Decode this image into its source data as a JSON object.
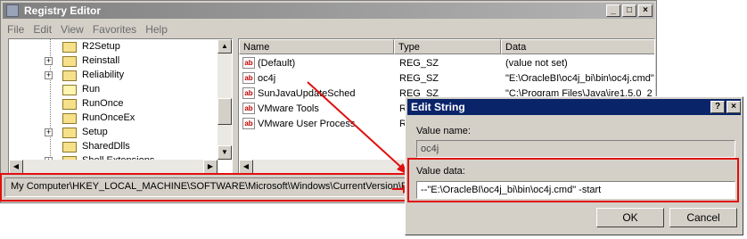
{
  "window": {
    "title": "Registry Editor"
  },
  "menu": [
    "File",
    "Edit",
    "View",
    "Favorites",
    "Help"
  ],
  "tree": [
    {
      "label": "R2Setup",
      "expander": ""
    },
    {
      "label": "Reinstall",
      "expander": "+"
    },
    {
      "label": "Reliability",
      "expander": "+"
    },
    {
      "label": "Run",
      "expander": ""
    },
    {
      "label": "RunOnce",
      "expander": ""
    },
    {
      "label": "RunOnceEx",
      "expander": ""
    },
    {
      "label": "Setup",
      "expander": "+"
    },
    {
      "label": "SharedDlls",
      "expander": ""
    },
    {
      "label": "Shell Extensions",
      "expander": "+"
    }
  ],
  "list": {
    "columns": [
      "Name",
      "Type",
      "Data"
    ],
    "rows": [
      {
        "name": "(Default)",
        "type": "REG_SZ",
        "data": "(value not set)"
      },
      {
        "name": "oc4j",
        "type": "REG_SZ",
        "data": "\"E:\\OracleBI\\oc4j_bi\\bin\\oc4j.cmd\""
      },
      {
        "name": "SunJavaUpdateSched",
        "type": "REG_SZ",
        "data": "\"C:\\Program Files\\Java\\jre1.5.0_2"
      },
      {
        "name": "VMware Tools",
        "type": "R",
        "data": ""
      },
      {
        "name": "VMware User Process",
        "type": "R",
        "data": ""
      }
    ]
  },
  "status": {
    "path": "My Computer\\HKEY_LOCAL_MACHINE\\SOFTWARE\\Microsoft\\Windows\\CurrentVersion\\Run"
  },
  "dialog": {
    "title": "Edit String",
    "help_btn": "?",
    "close_btn": "×",
    "value_name_label": "Value name:",
    "value_name": "oc4j",
    "value_data_label": "Value data:",
    "value_data": "--\"E:\\OracleBI\\oc4j_bi\\bin\\oc4j.cmd\" -start",
    "ok": "OK",
    "cancel": "Cancel"
  },
  "colors": {
    "highlight": "#e01010",
    "dialog_title": "#0a246a"
  }
}
